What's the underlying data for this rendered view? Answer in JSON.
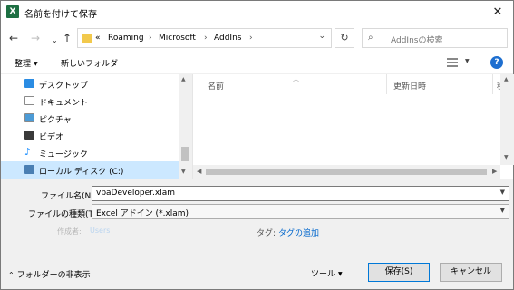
{
  "window": {
    "app_icon": "X",
    "title": "名前を付けて保存",
    "close": "✕"
  },
  "nav": {
    "back": "←",
    "forward": "→",
    "recent": "⌄",
    "up": "↑",
    "refresh": "↻"
  },
  "address": {
    "overflow": "«",
    "parts": [
      "Roaming",
      "Microsoft",
      "AddIns"
    ],
    "separator": "›",
    "dropdown": "⌄"
  },
  "search": {
    "placeholder": "AddInsの検索",
    "icon": "⌕"
  },
  "toolbar": {
    "organize": "整理",
    "new_folder": "新しいフォルダー",
    "help": "?"
  },
  "sidebar": {
    "items": [
      {
        "label": "デスクトップ",
        "icon": "desktop-icon",
        "color": "#2b8ce3"
      },
      {
        "label": "ドキュメント",
        "icon": "documents-icon",
        "color": "#8a8a8a"
      },
      {
        "label": "ピクチャ",
        "icon": "pictures-icon",
        "color": "#4c9bd6"
      },
      {
        "label": "ビデオ",
        "icon": "videos-icon",
        "color": "#3a3a3a"
      },
      {
        "label": "ミュージック",
        "icon": "music-icon",
        "color": "#1e90ff"
      },
      {
        "label": "ローカル ディスク (C:)",
        "icon": "drive-icon",
        "color": "#4a7fb3",
        "selected": true
      }
    ]
  },
  "filelist": {
    "columns": [
      "名前",
      "更新日時",
      "種"
    ]
  },
  "form": {
    "filename_label": "ファイル名(N):",
    "filename_value": "vbaDeveloper.xlam",
    "filetype_label": "ファイルの種類(T):",
    "filetype_value": "Excel アドイン (*.xlam)",
    "author_label": "作成者:",
    "author_value": "Users",
    "tags_label": "タグ:",
    "tags_value": "タグの追加"
  },
  "footer": {
    "hide_folders": "フォルダーの非表示",
    "tools": "ツール",
    "save": "保存(S)",
    "cancel": "キャンセル"
  },
  "colors": {
    "accent": "#0078d7",
    "selection": "#cce8ff",
    "link": "#0066cc"
  }
}
